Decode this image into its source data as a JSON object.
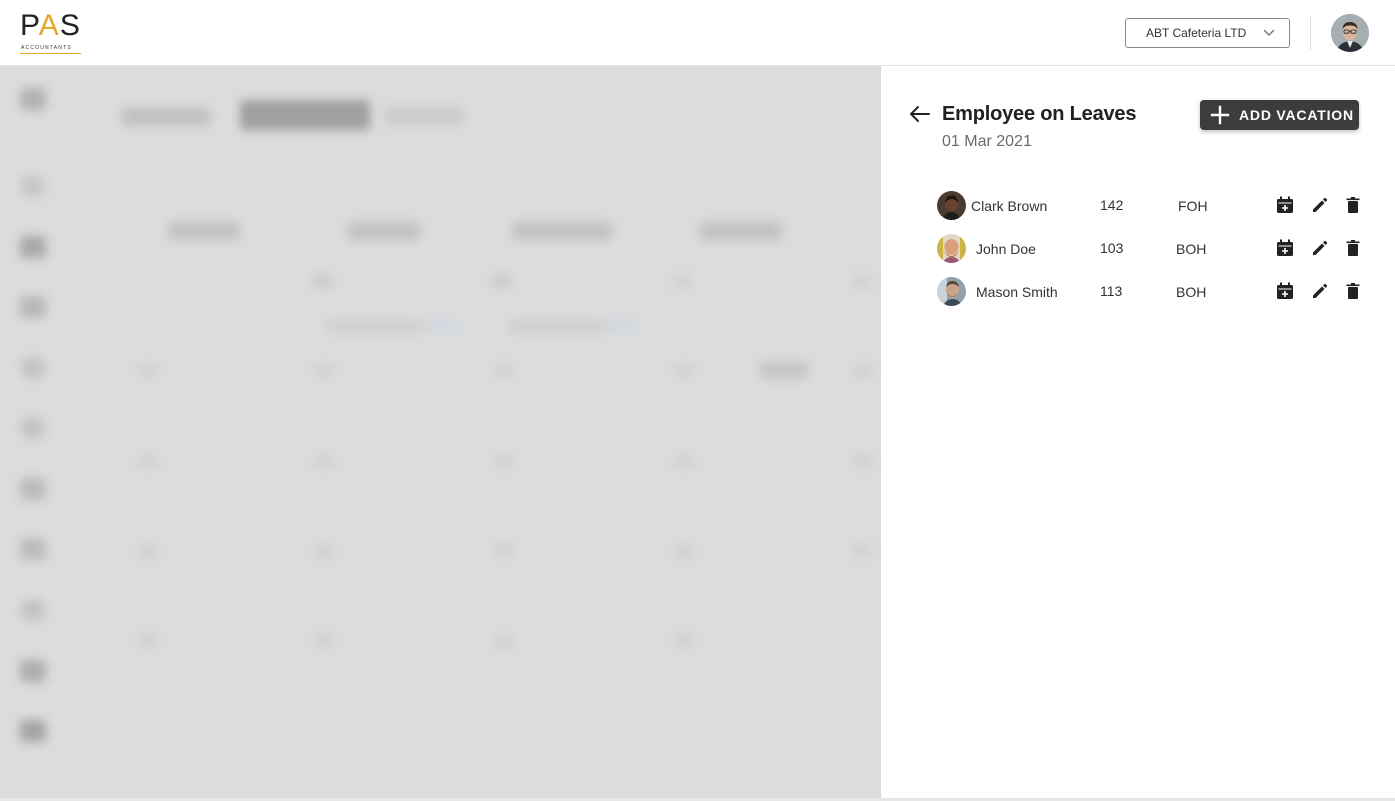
{
  "logo": {
    "main_left": "P",
    "main_a": "A",
    "main_right": "S",
    "sub": "ACCOUNTANTS"
  },
  "header": {
    "company": "ABT Cafeteria LTD"
  },
  "panel": {
    "title": "Employee on Leaves",
    "date": "01 Mar 2021",
    "add_button_label": "ADD VACATION",
    "employees": [
      {
        "name": "Clark Brown",
        "number": "142",
        "department": "FOH"
      },
      {
        "name": "John Doe",
        "number": "103",
        "department": "BOH"
      },
      {
        "name": "Mason Smith",
        "number": "113",
        "department": "BOH"
      }
    ]
  },
  "colors": {
    "accent_gold": "#e2a82b",
    "button_dark": "#3c3c3c",
    "backdrop": "#dcdcdc"
  },
  "icons": [
    "chevron-down-icon",
    "arrow-left-icon",
    "plus-icon",
    "calendar-add-icon",
    "pencil-icon",
    "trash-icon"
  ]
}
